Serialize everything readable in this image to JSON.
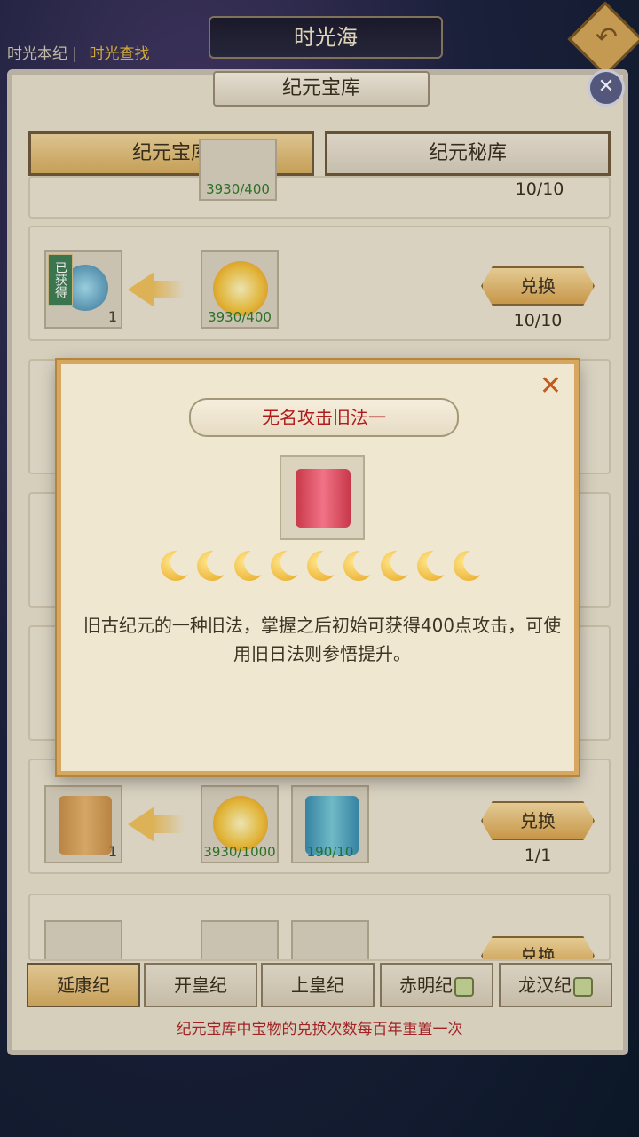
{
  "header": {
    "location_title": "时光海",
    "link_current": "时光本纪",
    "link_separator": "|",
    "link_search": "时光查找",
    "back_icon": "back-arrow-icon"
  },
  "panel": {
    "title": "纪元宝库",
    "tabs": [
      "纪元宝库",
      "纪元秘库"
    ],
    "active_tab": "纪元宝库"
  },
  "rows": [
    {
      "cost": "3930/400",
      "count": "10/10"
    },
    {
      "got_label": "已获得",
      "item_count": "1",
      "cost": "3930/400",
      "button": "兑换",
      "count": "10/10"
    },
    {
      "item_count": "1",
      "cost": "3930/1000",
      "cost2": "190/10",
      "button": "兑换",
      "count": "1/1"
    },
    {
      "button": "兑换"
    }
  ],
  "era_tabs": [
    {
      "label": "延康纪",
      "locked": false
    },
    {
      "label": "开皇纪",
      "locked": false
    },
    {
      "label": "上皇纪",
      "locked": false
    },
    {
      "label": "赤明纪",
      "locked": true
    },
    {
      "label": "龙汉纪",
      "locked": true
    }
  ],
  "footer_note": "纪元宝库中宝物的兑换次数每百年重置一次",
  "modal": {
    "title": "无名攻击旧法一",
    "close_symbol": "✕",
    "moon_count": 9,
    "description": "旧古纪元的一种旧法，掌握之后初始可获得400点攻击，可使用旧日法则参悟提升。"
  },
  "colors": {
    "accent_gold": "#d9a450",
    "title_red": "#b11b1b",
    "cost_green": "#2e7a2a"
  }
}
